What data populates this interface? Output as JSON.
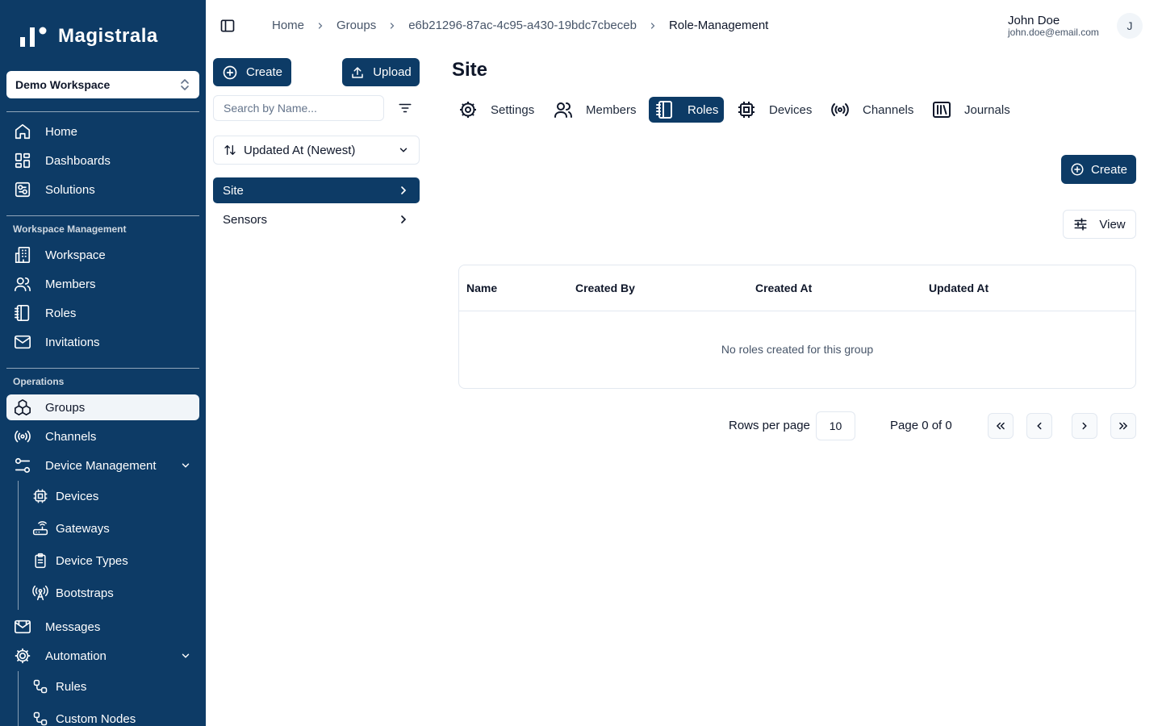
{
  "sidebar": {
    "logo_text": "Magistrala",
    "workspace_selector": "Demo Workspace",
    "main_items": [
      {
        "label": "Home",
        "icon": "home-icon"
      },
      {
        "label": "Dashboards",
        "icon": "dashboard-icon"
      },
      {
        "label": "Solutions",
        "icon": "solutions-icon"
      }
    ],
    "workspace_section_title": "Workspace Management",
    "workspace_items": [
      {
        "label": "Workspace",
        "icon": "building-icon"
      },
      {
        "label": "Members",
        "icon": "users-icon"
      },
      {
        "label": "Roles",
        "icon": "notebook-icon"
      },
      {
        "label": "Invitations",
        "icon": "mail-icon"
      }
    ],
    "operations_section_title": "Operations",
    "operations_items": [
      {
        "label": "Groups",
        "icon": "groups-icon",
        "active": true
      },
      {
        "label": "Channels",
        "icon": "radio-icon"
      },
      {
        "label": "Device Management",
        "icon": "settings-sliders-icon",
        "expanded": true
      }
    ],
    "device_management_children": [
      {
        "label": "Devices",
        "icon": "cpu-icon"
      },
      {
        "label": "Gateways",
        "icon": "router-icon"
      },
      {
        "label": "Device Types",
        "icon": "clipboard-icon"
      },
      {
        "label": "Bootstraps",
        "icon": "antenna-icon"
      }
    ],
    "messages_label": "Messages",
    "automation_label": "Automation",
    "automation_children": [
      {
        "label": "Rules",
        "icon": "workflow-icon"
      },
      {
        "label": "Custom Nodes",
        "icon": "workflow-icon"
      }
    ]
  },
  "header": {
    "breadcrumb": [
      "Home",
      "Groups",
      "e6b21296-87ac-4c95-a430-19bdc7cbeceb",
      "Role-Management"
    ],
    "user_name": "John Doe",
    "user_email": "john.doe@email.com",
    "avatar_initial": "J"
  },
  "left_panel": {
    "create_label": "Create",
    "upload_label": "Upload",
    "search_placeholder": "Search by Name...",
    "sort_label": "Updated At (Newest)",
    "groups": [
      {
        "label": "Site",
        "active": true
      },
      {
        "label": "Sensors",
        "active": false
      }
    ]
  },
  "main": {
    "title": "Site",
    "tabs": [
      {
        "label": "Settings",
        "icon": "cog-icon"
      },
      {
        "label": "Members",
        "icon": "users-icon"
      },
      {
        "label": "Roles",
        "icon": "notebook-icon",
        "active": true
      },
      {
        "label": "Devices",
        "icon": "cpu-icon"
      },
      {
        "label": "Channels",
        "icon": "radio-icon"
      },
      {
        "label": "Journals",
        "icon": "library-icon"
      }
    ],
    "create_label": "Create",
    "view_label": "View",
    "table": {
      "columns": [
        "Name",
        "Created By",
        "Created At",
        "Updated At"
      ],
      "empty_message": "No roles created for this group"
    },
    "pagination": {
      "rows_per_page_label": "Rows per page",
      "rows_per_page_value": "10",
      "page_text": "Page 0 of 0"
    }
  },
  "colors": {
    "brand": "#0d3b66",
    "border": "#e2e8f0"
  }
}
